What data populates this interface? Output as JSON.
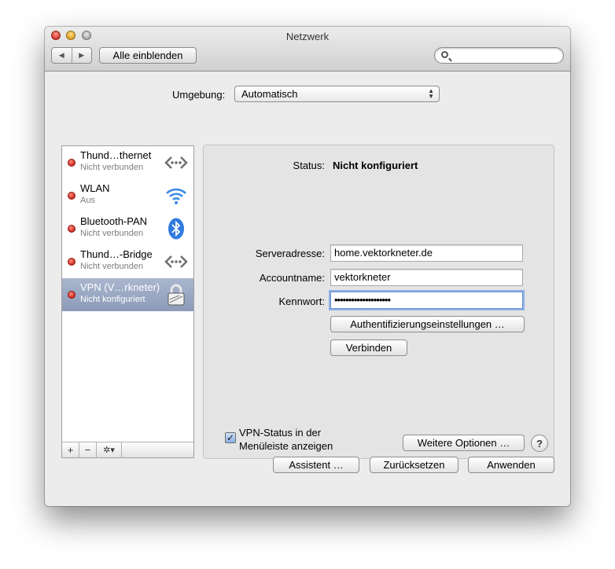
{
  "window": {
    "title": "Netzwerk"
  },
  "toolbar": {
    "back": "◀",
    "forward": "▶",
    "show_all": "Alle einblenden",
    "search_value": ""
  },
  "environment": {
    "label": "Umgebung:",
    "value": "Automatisch"
  },
  "services": [
    {
      "name": "Thund…thernet",
      "status": "Nicht verbunden",
      "icon": "ethernet-arrows-icon"
    },
    {
      "name": "WLAN",
      "status": "Aus",
      "icon": "wifi-icon"
    },
    {
      "name": "Bluetooth-PAN",
      "status": "Nicht verbunden",
      "icon": "bluetooth-icon"
    },
    {
      "name": "Thund…-Bridge",
      "status": "Nicht verbunden",
      "icon": "ethernet-arrows-icon"
    },
    {
      "name": "VPN (V…rkneter)",
      "status": "Nicht konfiguriert",
      "icon": "lock-icon",
      "selected": true
    }
  ],
  "sidebar_controls": {
    "add": "+",
    "remove": "−",
    "gear": "✲▾"
  },
  "detail": {
    "status_label": "Status:",
    "status_value": "Nicht konfiguriert",
    "server_label": "Serveradresse:",
    "server_value": "home.vektorkneter.de",
    "account_label": "Accountname:",
    "account_value": "vektorkneter",
    "password_label": "Kennwort:",
    "password_value": "••••••••••••••••••••",
    "auth_button": "Authentifizierungseinstellungen …",
    "connect_button": "Verbinden",
    "vpn_status_checkbox": "VPN-Status in der Menüleiste anzeigen",
    "vpn_status_checked": true,
    "more_options_button": "Weitere Optionen …",
    "help": "?"
  },
  "footer": {
    "assistant": "Assistent …",
    "revert": "Zurücksetzen",
    "apply": "Anwenden"
  },
  "colors": {
    "status_dot": "#d5362b",
    "selection": "#8d9bb8",
    "accent": "#3b8be6"
  }
}
